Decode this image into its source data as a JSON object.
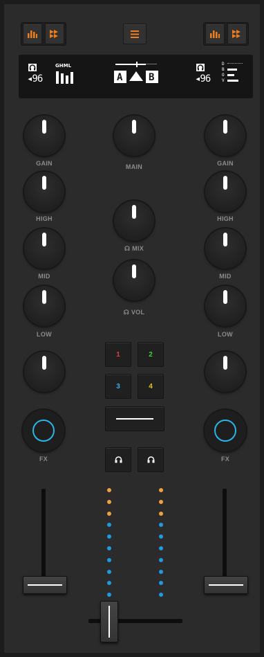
{
  "colors": {
    "accent": "#f07d1e",
    "cyan": "#29b6e8",
    "meter_orange": "#f0a040",
    "meter_blue": "#1e9be0",
    "pad1": "#e04040",
    "pad2": "#3bd43b",
    "pad3": "#29b6e8",
    "pad4": "#e8c020"
  },
  "header": {
    "left_icons": [
      "eq-bars-icon",
      "fast-forward-icon"
    ],
    "center_icon": "menu-icon",
    "right_icons": [
      "eq-bars-icon",
      "fast-forward-icon"
    ]
  },
  "display": {
    "left": {
      "icon": "headphones-icon",
      "value": "◂96",
      "eq_label": "GHML"
    },
    "center": {
      "label_a": "A",
      "label_b": "B"
    },
    "right": {
      "icon": "headphones-icon",
      "value": "◂96",
      "labels": [
        "D",
        "B",
        "O",
        "V"
      ]
    }
  },
  "left_deck": {
    "gain": "GAIN",
    "high": "HIGH",
    "mid": "MID",
    "low": "LOW",
    "fx": "FX"
  },
  "right_deck": {
    "gain": "GAIN",
    "high": "HIGH",
    "mid": "MID",
    "low": "LOW",
    "fx": "FX"
  },
  "center": {
    "main": "MAIN",
    "mix": "☊ MIX",
    "vol": "☊ VOL"
  },
  "pads": [
    {
      "label": "1"
    },
    {
      "label": "2"
    },
    {
      "label": "3"
    },
    {
      "label": "4"
    }
  ],
  "meters": {
    "left": [
      "orange",
      "orange",
      "orange",
      "blue",
      "blue",
      "blue",
      "blue",
      "blue",
      "blue",
      "blue"
    ],
    "right": [
      "orange",
      "orange",
      "orange",
      "blue",
      "blue",
      "blue",
      "blue",
      "blue",
      "blue",
      "blue"
    ]
  }
}
